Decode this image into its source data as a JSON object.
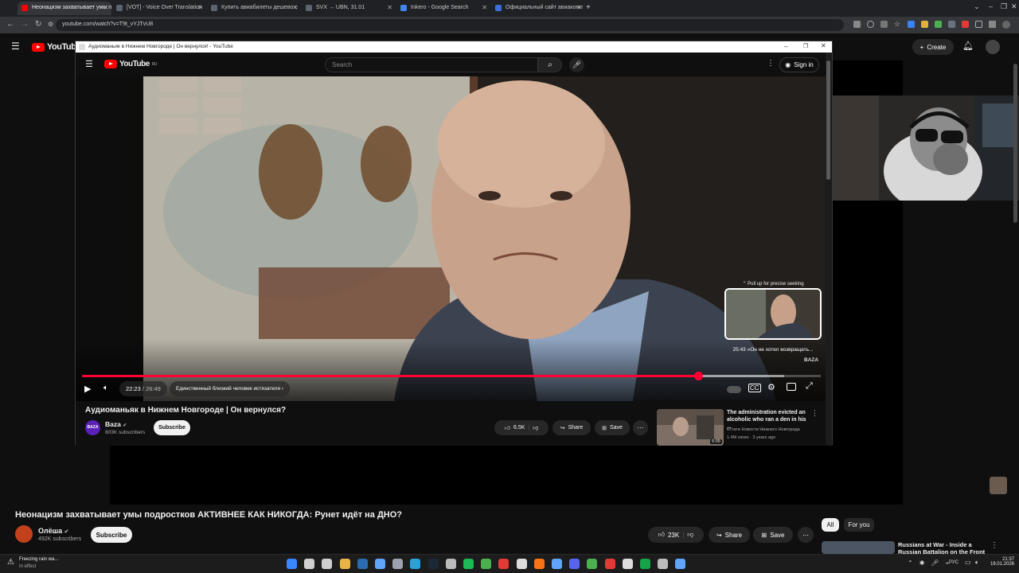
{
  "browser": {
    "tabs": [
      {
        "label": "Неонацизм захватывает умы под",
        "color": "#ff0000",
        "active": true
      },
      {
        "label": "[VOT] - Voice Over Translation",
        "color": "#5b6470",
        "active": false
      },
      {
        "label": "Купить авиабилеты дешево с",
        "color": "#5b6470",
        "active": false
      },
      {
        "label": "SVX → UBN, 31.01",
        "color": "#5b6470",
        "active": false
      },
      {
        "label": "Inkero - Google Search",
        "color": "#4285f4",
        "active": false
      },
      {
        "label": "Официальный сайт авиакомп",
        "color": "#3b6fd6",
        "active": false
      }
    ],
    "url": "youtube.com/watch?v=T9t_vYJTvU8",
    "new_tab": "+"
  },
  "bg_page": {
    "logo_text": "YouTube",
    "create_label": "Create",
    "video_title": "Неонацизм захватывает умы подростков АКТИВНЕЕ КАК НИКОГДА: Рунет идёт на ДНО?",
    "channel_name": "Олёша",
    "subscribers": "492K subscribers",
    "subscribe_label": "Subscribe",
    "likes": "23K",
    "share_label": "Share",
    "save_label": "Save",
    "chips": [
      "All",
      "For you"
    ],
    "rec_title": "Russians at War - Inside a Russian Battalion on the Front"
  },
  "popup": {
    "window_title": "Аудиоманьяк в Нижнем Новгороде | Он вернулся! - YouTube",
    "logo_text": "YouTube",
    "logo_region": "RU",
    "search_placeholder": "Search",
    "sign_in": "Sign in",
    "player": {
      "current_time": "22:23",
      "duration": "26:49",
      "time_sep": "/",
      "chapter": "Единственный близкий человек истязателя",
      "progress": 0.8345,
      "buffered": 0.95,
      "preview_hint": "Pull up for precise seeking",
      "preview_time": "25:43",
      "preview_chapter": "«Он не хотел возвращать...",
      "watermark": "BAZA"
    },
    "video_title": "Аудиоманьяк в Нижнем Новгороде | Он вернулся?",
    "channel_name": "Baza",
    "channel_avatar_text": "BAZA",
    "subscribers": "803K subscribers",
    "subscribe_label": "Subscribe",
    "likes": "6.5K",
    "share_label": "Share",
    "save_label": "Save",
    "rec": {
      "title": "The administration evicted an alcoholic who ran a den in his ...",
      "channel": "Кстати Новости Нижнего Новгорода",
      "meta": "1.4M views · 3 years ago",
      "duration": "6:05"
    }
  },
  "taskbar": {
    "weather_title": "Freezing rain wa...",
    "weather_sub": "In effect",
    "lang": "РУС",
    "time": "21:37",
    "date": "19.01.2026"
  },
  "colors": {
    "yt_red": "#ff0033",
    "bg": "#0f0f0f",
    "tab_active": "#35363a"
  }
}
